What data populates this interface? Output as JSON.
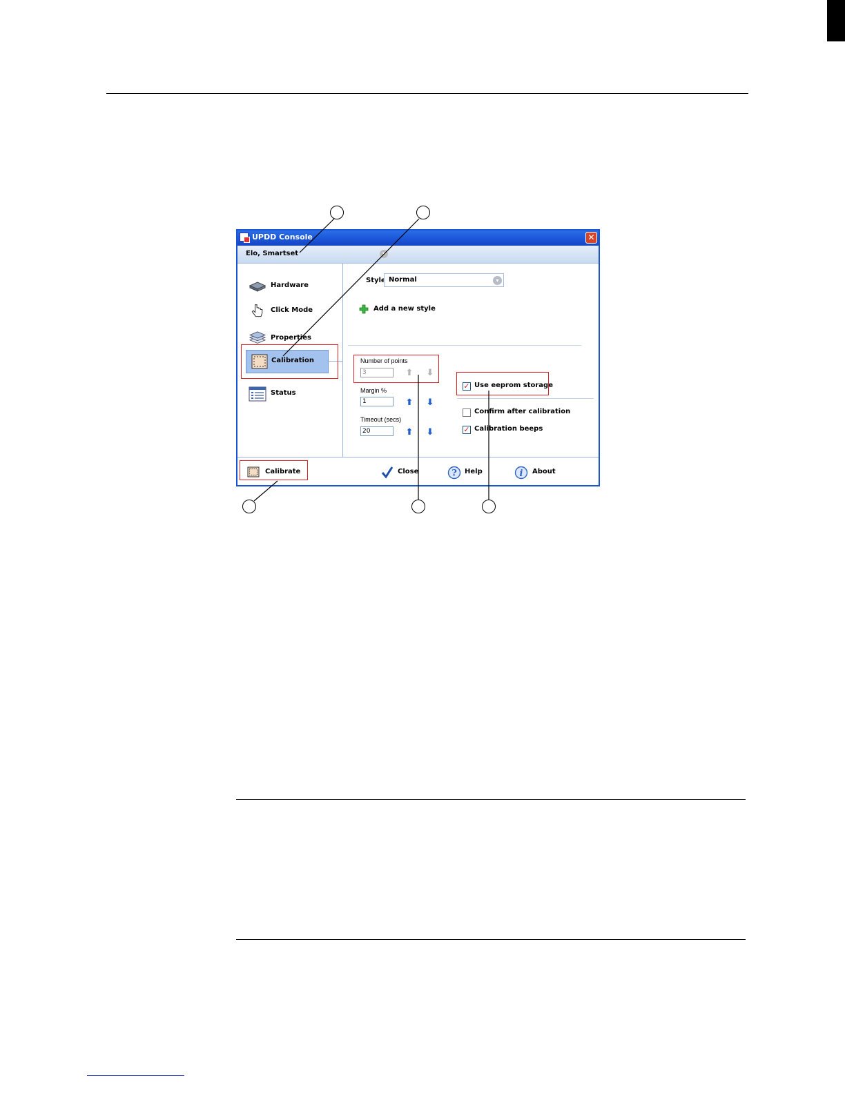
{
  "dialog": {
    "title": "UPDD Console",
    "device": "Elo, Smartset",
    "nav": [
      {
        "label": "Hardware",
        "icon": "hardware-icon"
      },
      {
        "label": "Click Mode",
        "icon": "hand-pointer-icon"
      },
      {
        "label": "Properties",
        "icon": "layers-icon"
      },
      {
        "label": "Calibration",
        "icon": "calibration-icon",
        "selected": true
      },
      {
        "label": "Status",
        "icon": "status-list-icon"
      }
    ],
    "style_label": "Style",
    "style_value": "Normal",
    "add_style": "Add a new style",
    "points_label": "Number of points",
    "points_value": "3",
    "margin_label": "Margin %",
    "margin_value": "1",
    "timeout_label": "Timeout (secs)",
    "timeout_value": "20",
    "eeprom_label": "Use eeprom storage",
    "eeprom_checked": true,
    "confirm_label": "Confirm after calibration",
    "confirm_checked": false,
    "beeps_label": "Calibration beeps",
    "beeps_checked": true,
    "buttons": {
      "calibrate": "Calibrate",
      "close": "Close",
      "help": "Help",
      "about": "About"
    }
  },
  "colors": {
    "titlebar": "#1a54d6",
    "selection": "#a4c2ee",
    "highlight_box": "#e02020",
    "arrow_blue": "#1f5fcf"
  }
}
